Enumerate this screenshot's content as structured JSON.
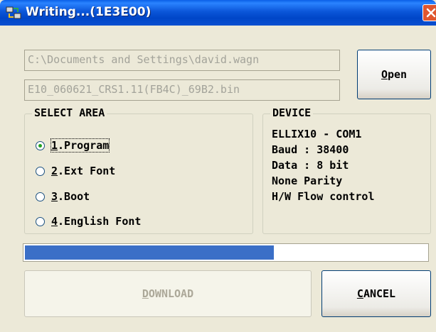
{
  "window": {
    "title": "Writing...(1E3E00)",
    "title_icon": "transfer-app-icon",
    "close_icon": "close-icon"
  },
  "path_field": {
    "value": "C:\\Documents and Settings\\david.wagn"
  },
  "file_field": {
    "value": "E10_060621_CRS1.11(FB4C)_69B2.bin"
  },
  "open_button": {
    "label_mnemonic": "O",
    "label_rest": "pen"
  },
  "select_area": {
    "title": "SELECT AREA",
    "options": [
      {
        "mnemonic": "1",
        "rest": ".Program",
        "checked": true
      },
      {
        "mnemonic": "2",
        "rest": ".Ext Font",
        "checked": false
      },
      {
        "mnemonic": "3",
        "rest": ".Boot",
        "checked": false
      },
      {
        "mnemonic": "4",
        "rest": ".English Font",
        "checked": false
      }
    ]
  },
  "device": {
    "title": "DEVICE",
    "lines": [
      "ELLIX10 - COM1",
      "Baud : 38400",
      "Data : 8 bit",
      "None Parity",
      "H/W Flow control"
    ]
  },
  "progress": {
    "fraction": 0.62,
    "color": "#3b6fc7"
  },
  "download_button": {
    "label_mnemonic": "D",
    "label_rest": "OWNLOAD",
    "enabled": false
  },
  "cancel_button": {
    "label_mnemonic": "C",
    "label_rest": "ANCEL"
  },
  "colors": {
    "titlebar": "#0054e3",
    "dialog_bg": "#ece9d8",
    "disabled_text": "#a3a39a"
  }
}
